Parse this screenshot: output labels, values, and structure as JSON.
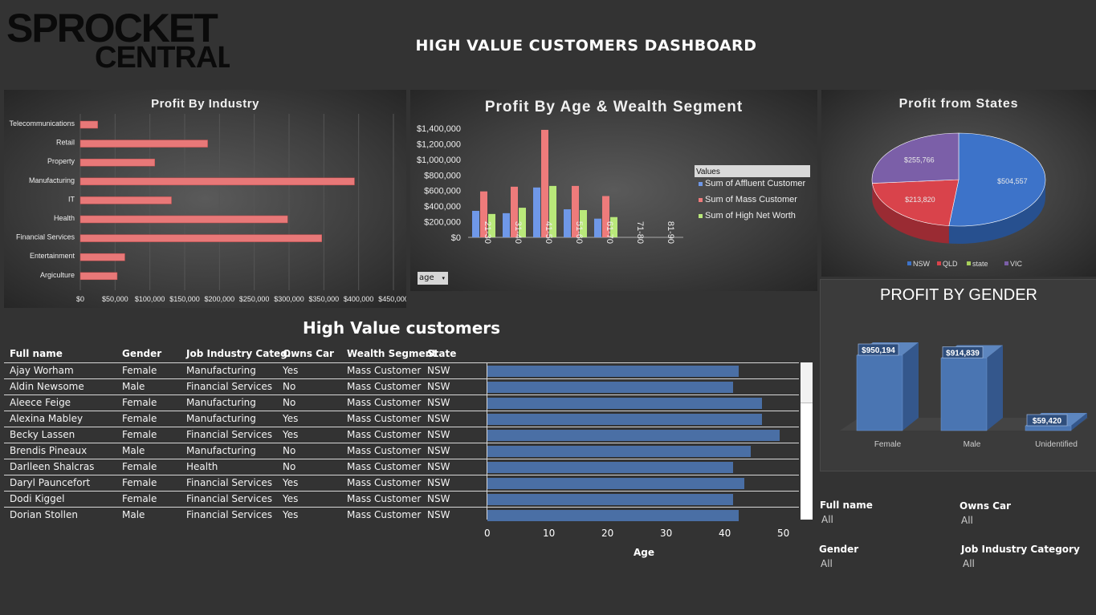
{
  "logo": {
    "line1": "SPROCKET",
    "line2": "CENTRAL"
  },
  "dashboard_title": "HIGH VALUE CUSTOMERS DASHBOARD",
  "industry_chart": {
    "title": "Profit By Industry",
    "x_ticks": [
      "$0",
      "$50,000",
      "$100,000",
      "$150,000",
      "$200,000",
      "$250,000",
      "$300,000",
      "$350,000",
      "$400,000",
      "$450,000"
    ],
    "bar_color": "#e87878"
  },
  "age_chart": {
    "title": "Profit By Age & Wealth Segment",
    "y_ticks": [
      "$1,400,000",
      "$1,200,000",
      "$1,000,000",
      "$800,000",
      "$600,000",
      "$400,000",
      "$200,000",
      "$0"
    ],
    "legend_title": "Values",
    "filter_label": "age"
  },
  "states_chart": {
    "title": "Profit from States"
  },
  "gender_chart": {
    "title": "PROFIT BY GENDER"
  },
  "table": {
    "title": "High Value customers",
    "headers": [
      "Full name",
      "Gender",
      "Job Industry Categ..",
      "Owns Car",
      "Wealth Segment",
      "State"
    ],
    "rows": [
      {
        "name": "Ajay Worham",
        "gender": "Female",
        "industry": "Manufacturing",
        "car": "Yes",
        "segment": "Mass Customer",
        "state": "NSW",
        "age": 43
      },
      {
        "name": "Aldin Newsome",
        "gender": "Male",
        "industry": "Financial Services",
        "car": "No",
        "segment": "Mass Customer",
        "state": "NSW",
        "age": 42
      },
      {
        "name": "Aleece Feige",
        "gender": "Female",
        "industry": "Manufacturing",
        "car": "No",
        "segment": "Mass Customer",
        "state": "NSW",
        "age": 47
      },
      {
        "name": "Alexina Mabley",
        "gender": "Female",
        "industry": "Manufacturing",
        "car": "Yes",
        "segment": "Mass Customer",
        "state": "NSW",
        "age": 47
      },
      {
        "name": "Becky Lassen",
        "gender": "Female",
        "industry": "Financial Services",
        "car": "Yes",
        "segment": "Mass Customer",
        "state": "NSW",
        "age": 50
      },
      {
        "name": "Brendis Pineaux",
        "gender": "Male",
        "industry": "Manufacturing",
        "car": "No",
        "segment": "Mass Customer",
        "state": "NSW",
        "age": 45
      },
      {
        "name": "Darlleen Shalcras",
        "gender": "Female",
        "industry": "Health",
        "car": "No",
        "segment": "Mass Customer",
        "state": "NSW",
        "age": 42
      },
      {
        "name": "Daryl Pauncefort",
        "gender": "Female",
        "industry": "Financial Services",
        "car": "Yes",
        "segment": "Mass Customer",
        "state": "NSW",
        "age": 44
      },
      {
        "name": "Dodi Kiggel",
        "gender": "Female",
        "industry": "Financial Services",
        "car": "Yes",
        "segment": "Mass Customer",
        "state": "NSW",
        "age": 42
      },
      {
        "name": "Dorian Stollen",
        "gender": "Male",
        "industry": "Financial Services",
        "car": "Yes",
        "segment": "Mass Customer",
        "state": "NSW",
        "age": 43
      }
    ],
    "age_ticks": [
      "0",
      "10",
      "20",
      "30",
      "40",
      "50"
    ],
    "age_axis_label": "Age"
  },
  "filters": {
    "full_name": {
      "label": "Full name",
      "value": "All"
    },
    "owns_car": {
      "label": "Owns Car",
      "value": "All"
    },
    "gender": {
      "label": "Gender",
      "value": "All"
    },
    "job_industry": {
      "label": "Job Industry Category",
      "value": "All"
    }
  },
  "chart_data": [
    {
      "type": "bar",
      "orientation": "horizontal",
      "title": "Profit By Industry",
      "categories": [
        "Telecommunications",
        "Retail",
        "Property",
        "Manufacturing",
        "IT",
        "Health",
        "Financial Services",
        "Entertainment",
        "Argiculture"
      ],
      "values": [
        25000,
        183000,
        107000,
        394000,
        131000,
        298000,
        347000,
        64000,
        53000
      ],
      "xlim": [
        0,
        450000
      ]
    },
    {
      "type": "bar",
      "title": "Profit By Age & Wealth Segment",
      "categories": [
        "21-30",
        "31-40",
        "41-50",
        "51-60",
        "61-70",
        "71-80",
        "81-90"
      ],
      "series": [
        {
          "name": "Sum of Affluent Customer",
          "color": "#6f98e8",
          "values": [
            340000,
            310000,
            640000,
            360000,
            240000,
            0,
            0
          ]
        },
        {
          "name": "Sum of Mass Customer",
          "color": "#ee7b7b",
          "values": [
            590000,
            650000,
            1380000,
            660000,
            530000,
            0,
            0
          ]
        },
        {
          "name": "Sum of High Net Worth",
          "color": "#b9e87a",
          "values": [
            300000,
            380000,
            660000,
            350000,
            260000,
            0,
            0
          ]
        }
      ],
      "ylim": [
        0,
        1400000
      ]
    },
    {
      "type": "pie",
      "title": "Profit from States",
      "labels": [
        "NSW",
        "QLD",
        "state",
        "VIC"
      ],
      "values": [
        504557,
        213820,
        0,
        255766
      ],
      "data_labels": [
        "$504,557",
        "$213,820",
        "",
        "$255,766"
      ],
      "colors": [
        "#3d73c9",
        "#d9434b",
        "#a7d05a",
        "#7b5fa8"
      ]
    },
    {
      "type": "bar",
      "title": "PROFIT BY GENDER",
      "categories": [
        "Female",
        "Male",
        "Unidentified"
      ],
      "values": [
        950194,
        914839,
        59420
      ],
      "data_labels": [
        "$950,194",
        "$914,839",
        "$59,420"
      ]
    }
  ]
}
